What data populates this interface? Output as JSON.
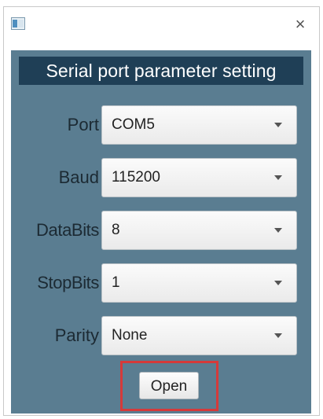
{
  "window": {
    "close_glyph": "×",
    "icon": "app-window-icon"
  },
  "dialog": {
    "title": "Serial port parameter setting"
  },
  "fields": [
    {
      "label": "Port",
      "value": "COM5"
    },
    {
      "label": "Baud",
      "value": "115200"
    },
    {
      "label": "DataBits",
      "value": "8"
    },
    {
      "label": "StopBits",
      "value": "1"
    },
    {
      "label": "Parity",
      "value": "None"
    }
  ],
  "actions": {
    "open_label": "Open"
  },
  "colors": {
    "panel": "#5a7d91",
    "header": "#1f3f56",
    "highlight": "#d53a3a"
  }
}
